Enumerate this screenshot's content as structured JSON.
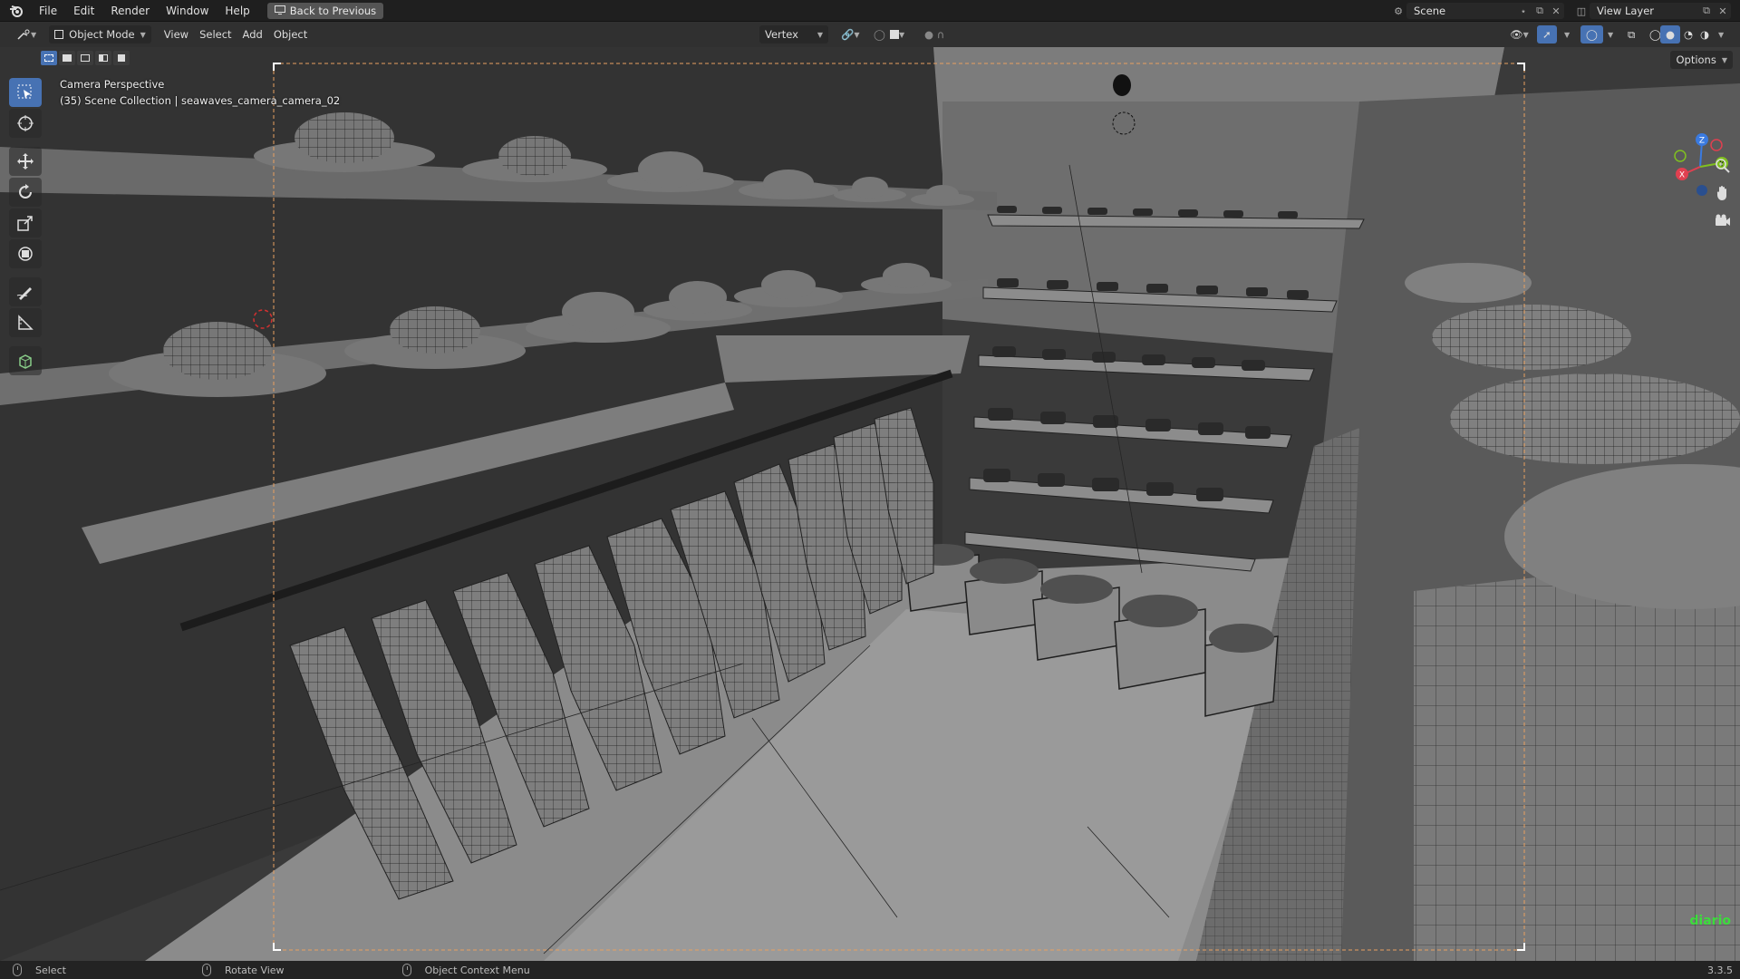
{
  "menubar": {
    "items": [
      "File",
      "Edit",
      "Render",
      "Window",
      "Help"
    ],
    "back_button": "Back to Previous"
  },
  "scene_selector": {
    "value": "Scene"
  },
  "view_layer_selector": {
    "value": "View Layer"
  },
  "viewport_header": {
    "mode": "Object Mode",
    "menus": [
      "View",
      "Select",
      "Add",
      "Object"
    ],
    "snap_target": "Vertex",
    "options": "Options"
  },
  "viewport": {
    "camera_label": "Camera Perspective",
    "collection_label": "(35) Scene Collection | seawaves_camera_camera_02",
    "watermark": "diario"
  },
  "statusbar": {
    "select": "Select",
    "rotate": "Rotate View",
    "context": "Object Context Menu",
    "version": "3.3.5"
  },
  "colors": {
    "accent": "#4772b3",
    "camera_frame": "#e8a060",
    "axis_x": "#e04050",
    "axis_y": "#80c020",
    "axis_z": "#3a7ae0",
    "watermark": "#3cdc3c"
  }
}
